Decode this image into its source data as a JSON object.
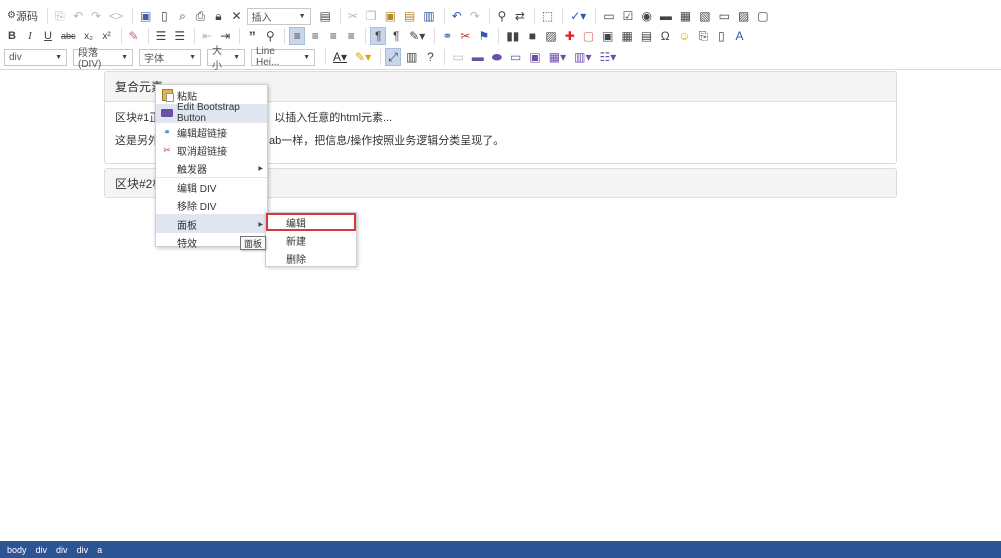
{
  "toolbar": {
    "row1": {
      "source_label": "源码",
      "insert_combo": "插入"
    },
    "row2": {
      "bold": "B",
      "italic": "I",
      "underline": "U",
      "strike": "abc",
      "subscript": "x₂",
      "superscript": "x²",
      "quote": "”",
      "omega": "Ω"
    },
    "row3": {
      "format_combo": "div",
      "paragraph_combo": "段落(DIV)",
      "font_combo": "字体",
      "size_combo": "大小",
      "lineheight_combo": "Line Hei..."
    }
  },
  "content": {
    "panel1": {
      "title": "复合元素",
      "line1_start": "区块#1正",
      "line1_end": "以插入任意的html元素...",
      "line2_start": "这是另外",
      "line2_end": "ab一样，把信息/操作按照业务逻辑分类呈现了。"
    },
    "panel2": {
      "title": "区块#2标"
    }
  },
  "context_menu": {
    "items": [
      {
        "label": "粘贴",
        "icon": "paste-icon"
      },
      {
        "label": "Edit Bootstrap Button",
        "icon": "bootstrap-button-icon"
      },
      {
        "label": "编辑超链接",
        "icon": "link-icon"
      },
      {
        "label": "取消超链接",
        "icon": "unlink-icon"
      },
      {
        "label": "触发器",
        "icon": ""
      },
      {
        "label": "编辑 DIV",
        "icon": ""
      },
      {
        "label": "移除 DIV",
        "icon": ""
      },
      {
        "label": "面板",
        "icon": ""
      },
      {
        "label": "特效",
        "icon": ""
      }
    ],
    "submenu": {
      "items": [
        "编辑",
        "新建",
        "删除"
      ]
    },
    "tooltip": "面板"
  },
  "statusbar": {
    "path": [
      "body",
      "div",
      "div",
      "div",
      "a"
    ]
  },
  "colors": {
    "statusbar": "#2c5394",
    "submenu_highlight_border": "#d9383a",
    "active_button": "#c8d6ec",
    "panel_heading": "#f5f5f5"
  }
}
